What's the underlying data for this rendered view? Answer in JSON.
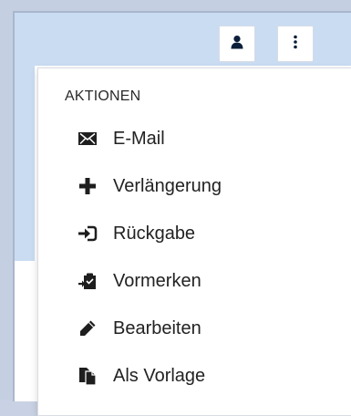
{
  "menu": {
    "header": "AKTIONEN",
    "items": [
      {
        "label": "E-Mail",
        "icon": "envelope-icon"
      },
      {
        "label": "Verlängerung",
        "icon": "plus-icon"
      },
      {
        "label": "Rückgabe",
        "icon": "return-icon"
      },
      {
        "label": "Vormerken",
        "icon": "reserve-icon"
      },
      {
        "label": "Bearbeiten",
        "icon": "pencil-icon"
      },
      {
        "label": "Als Vorlage",
        "icon": "copy-icon"
      }
    ]
  },
  "toolbar": {
    "user_icon": "user-icon",
    "menu_icon": "vertical-dots-icon"
  },
  "colors": {
    "background": "#c5cfe2",
    "header": "#c9dcf2",
    "menu_background": "#ffffff",
    "text": "#222222"
  }
}
